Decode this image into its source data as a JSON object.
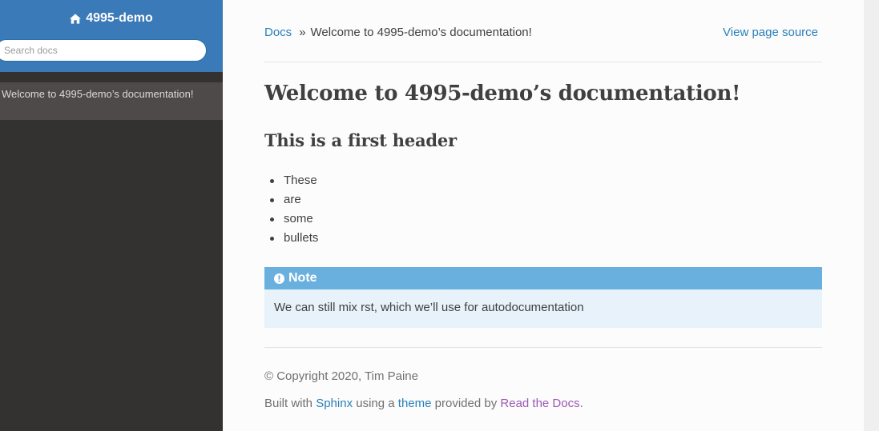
{
  "sidebar": {
    "brand": "4995-demo",
    "search_placeholder": "Search docs",
    "nav_items": [
      {
        "label": "Welcome to 4995-demo’s documentation!"
      }
    ]
  },
  "breadcrumbs": {
    "docs_link": "Docs",
    "separator": "»",
    "current": "Welcome to 4995-demo’s documentation!",
    "view_source": "View page source"
  },
  "main": {
    "title": "Welcome to 4995-demo’s documentation!",
    "subtitle": "This is a first header",
    "bullets": [
      "These",
      "are",
      "some",
      "bullets"
    ],
    "note": {
      "heading": "Note",
      "body": "We can still mix rst, which we’ll use for autodocumentation"
    }
  },
  "footer": {
    "copyright": "© Copyright 2020, Tim Paine",
    "built_prefix": "Built with ",
    "sphinx": "Sphinx",
    "using": " using a ",
    "theme": "theme",
    "provided": " provided by ",
    "rtd": "Read the Docs",
    "period": "."
  },
  "colors": {
    "sidebar_top": "#3b7ab8",
    "sidebar_bg": "#343131",
    "link": "#2980b9",
    "note_header": "#6ab0de",
    "note_bg": "#e7f2fa",
    "rtd_link": "#9b59b6"
  },
  "icons": {
    "brand": "home-icon",
    "note": "exclamation-circle-icon"
  }
}
